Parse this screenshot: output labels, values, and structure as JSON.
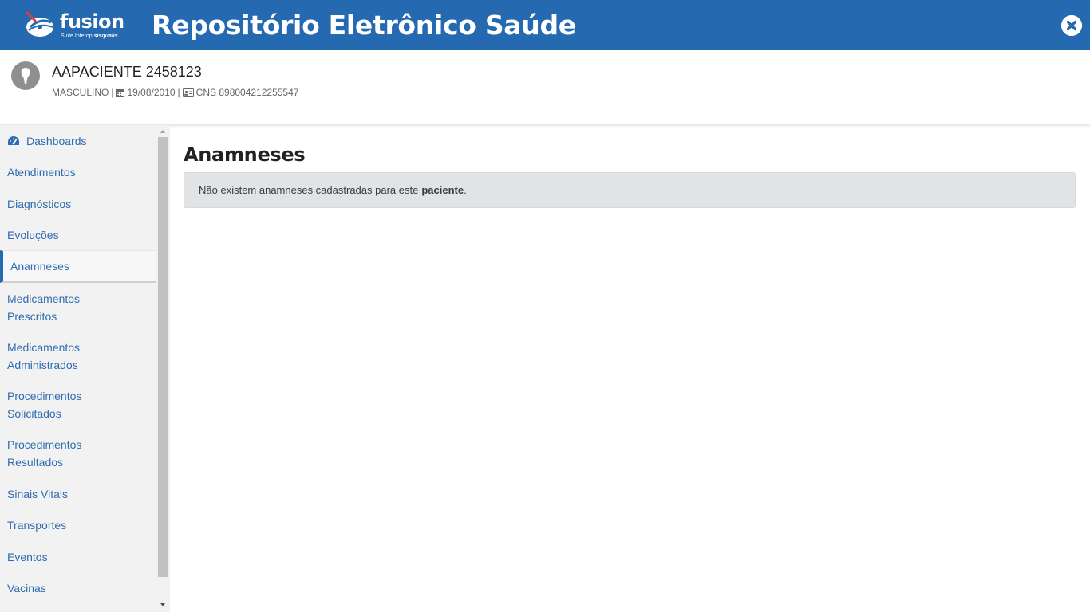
{
  "header": {
    "logo_word": "fusion",
    "logo_tagline": "Suite Interop",
    "logo_brand": "sisqualis",
    "title": "Repositório Eletrônico Saúde",
    "close_icon": "close-circle-icon"
  },
  "patient": {
    "name": "AAPACIENTE 2458123",
    "sex": "MASCULINO",
    "birth_date": "19/08/2010",
    "cns_label": "CNS",
    "cns": "898004212255547"
  },
  "sidebar": {
    "items": [
      {
        "label": "Dashboards",
        "icon": "dashboard-icon"
      },
      {
        "label": "Atendimentos"
      },
      {
        "label": "Diagnósticos"
      },
      {
        "label": "Evoluções"
      },
      {
        "label": "Anamneses",
        "active": true
      },
      {
        "label": "Medicamentos Prescritos"
      },
      {
        "label": "Medicamentos Administrados"
      },
      {
        "label": "Procedimentos Solicitados"
      },
      {
        "label": "Procedimentos Resultados"
      },
      {
        "label": "Sinais Vitais"
      },
      {
        "label": "Transportes"
      },
      {
        "label": "Eventos"
      },
      {
        "label": "Vacinas"
      }
    ]
  },
  "main": {
    "title": "Anamneses",
    "alert_text": "Não existem anamneses cadastradas para este",
    "alert_bold": "paciente",
    "alert_end": "."
  },
  "colors": {
    "brand": "#2569b0",
    "link": "#2f6cb0",
    "sidebar_bg": "#f2f2f2",
    "alert_bg": "#e2e3e5"
  }
}
